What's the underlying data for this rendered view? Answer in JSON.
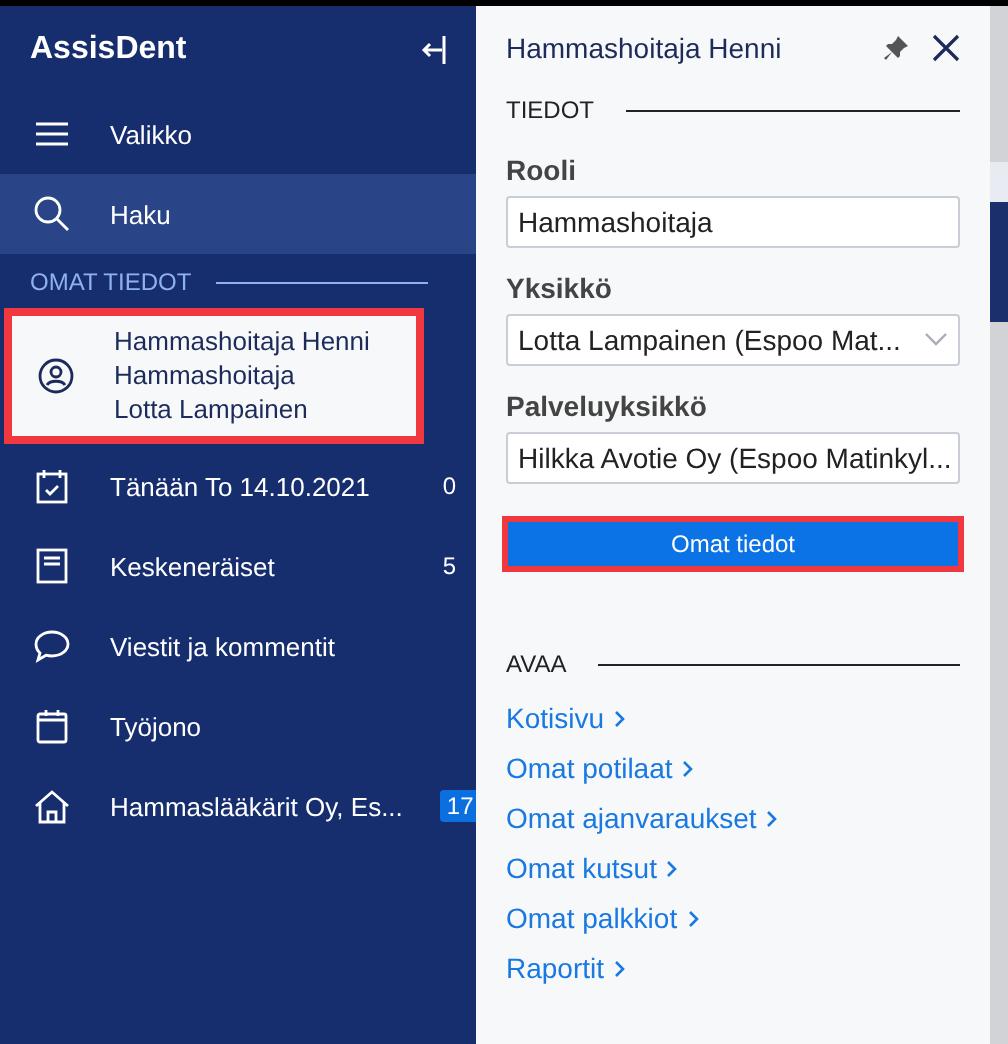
{
  "sidebar": {
    "app_title": "AssisDent",
    "top_items": [
      {
        "label": "Valikko",
        "selected": false
      },
      {
        "label": "Haku",
        "selected": true
      }
    ],
    "section_label": "OMAT TIEDOT",
    "profile": {
      "lines": [
        "Hammashoitaja Henni",
        "Hammashoitaja",
        "Lotta Lampainen"
      ],
      "highlighted": true
    },
    "items": [
      {
        "label": "Tänään To 14.10.2021",
        "count": "0",
        "kind": "count"
      },
      {
        "label": "Keskeneräiset",
        "count": "5",
        "kind": "count"
      },
      {
        "label": "Viestit ja kommentit",
        "kind": "plain"
      },
      {
        "label": "Työjono",
        "kind": "plain"
      },
      {
        "label": "Hammaslääkärit Oy, Es...",
        "count": "17",
        "kind": "badge"
      }
    ]
  },
  "panel": {
    "title": "Hammashoitaja Henni",
    "section_label": "TIEDOT",
    "fields": [
      {
        "label": "Rooli",
        "value": "Hammashoitaja",
        "kind": "input"
      },
      {
        "label": "Yksikkö",
        "value": "Lotta Lampainen (Espoo Mat...",
        "kind": "select"
      },
      {
        "label": "Palveluyksikkö",
        "value": "Hilkka Avotie Oy (Espoo Matinkyl...",
        "kind": "input"
      }
    ],
    "button": {
      "label": "Omat tiedot",
      "highlighted": true
    },
    "links_label": "AVAA",
    "links": [
      "Kotisivu",
      "Omat potilaat",
      "Omat ajanvaraukset",
      "Omat kutsut",
      "Omat palkkiot",
      "Raportit"
    ]
  }
}
